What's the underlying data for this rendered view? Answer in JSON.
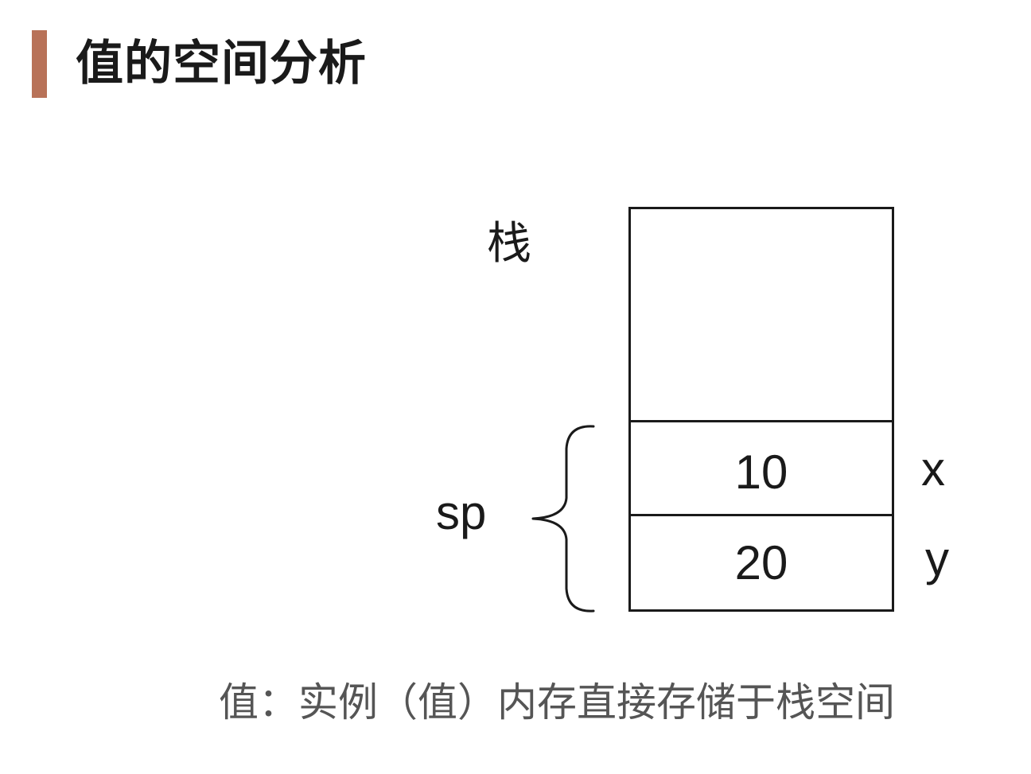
{
  "header": {
    "title": "值的空间分析"
  },
  "diagram": {
    "stack_label": "栈",
    "cells": [
      {
        "value": "10",
        "variable": "x"
      },
      {
        "value": "20",
        "variable": "y"
      }
    ],
    "group_label": "sp"
  },
  "caption": "值：实例（值）内存直接存储于栈空间",
  "colors": {
    "accent_bar": "#b87258",
    "stroke": "#1a1a1a",
    "caption_text": "#555555"
  }
}
